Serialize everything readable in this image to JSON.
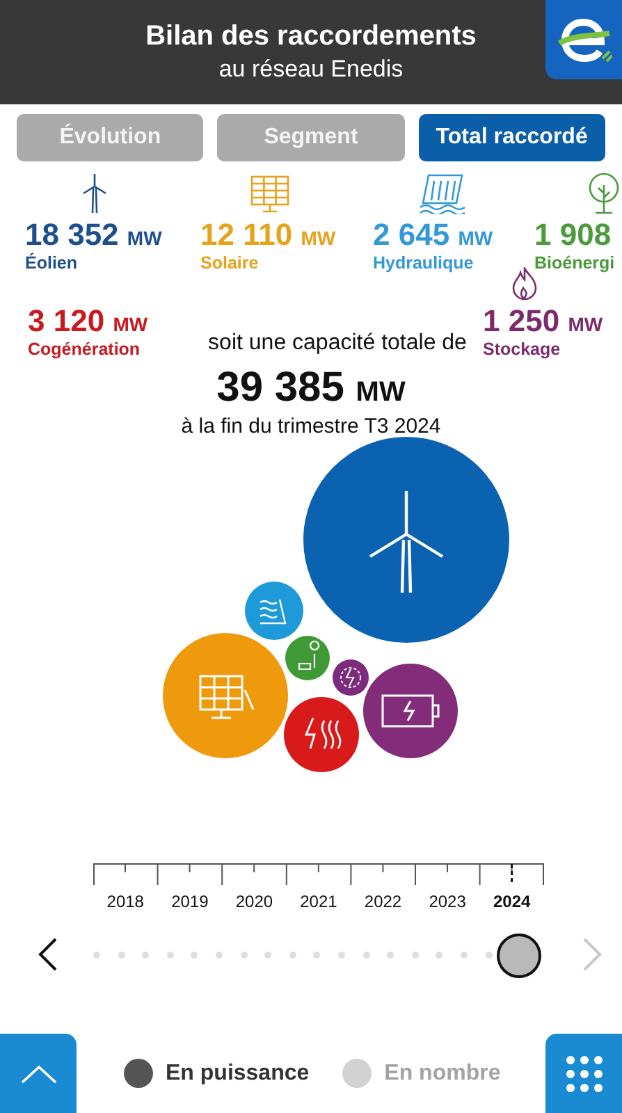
{
  "header": {
    "title": "Bilan des raccordements",
    "subtitle": "au réseau Enedis"
  },
  "tabs": [
    {
      "label": "Évolution",
      "selected": false
    },
    {
      "label": "Segment",
      "selected": false
    },
    {
      "label": "Total raccordé",
      "selected": true
    }
  ],
  "energies": [
    {
      "kind": "wind",
      "value": "18 352",
      "unit": "MW",
      "label": "Éolien",
      "color": "#1d4f8c"
    },
    {
      "kind": "solar",
      "value": "12 110",
      "unit": "MW",
      "label": "Solaire",
      "color": "#e6a21a"
    },
    {
      "kind": "hydro",
      "value": "2 645",
      "unit": "MW",
      "label": "Hydraulique",
      "color": "#3399d6"
    },
    {
      "kind": "bio",
      "value": "1 908",
      "label": "Bioénergi",
      "color": "#4b9a3c"
    }
  ],
  "energies_row2": [
    {
      "kind": "cogeneration",
      "value": "3 120",
      "unit": "MW",
      "label": "Cogénération",
      "color": "#c8191e"
    },
    {
      "kind": "storage",
      "value": "1 250",
      "unit": "MW",
      "label": "Stockage",
      "color": "#7b2b6b"
    }
  ],
  "total": {
    "prefix": "soit une capacité totale de",
    "value": "39 385",
    "unit": "MW",
    "suffix": "à la fin du trimestre T3 2024"
  },
  "timeline": {
    "years": [
      {
        "label": "2018",
        "selected": false
      },
      {
        "label": "2019",
        "selected": false
      },
      {
        "label": "2020",
        "selected": false
      },
      {
        "label": "2021",
        "selected": false
      },
      {
        "label": "2022",
        "selected": false
      },
      {
        "label": "2023",
        "selected": false
      },
      {
        "label": "2024",
        "selected": true
      }
    ],
    "level": 0.94,
    "prev_disabled": false,
    "next_disabled": true
  },
  "modes": [
    {
      "label": "En puissance",
      "selected": true
    },
    {
      "label": "En nombre",
      "selected": false
    }
  ]
}
